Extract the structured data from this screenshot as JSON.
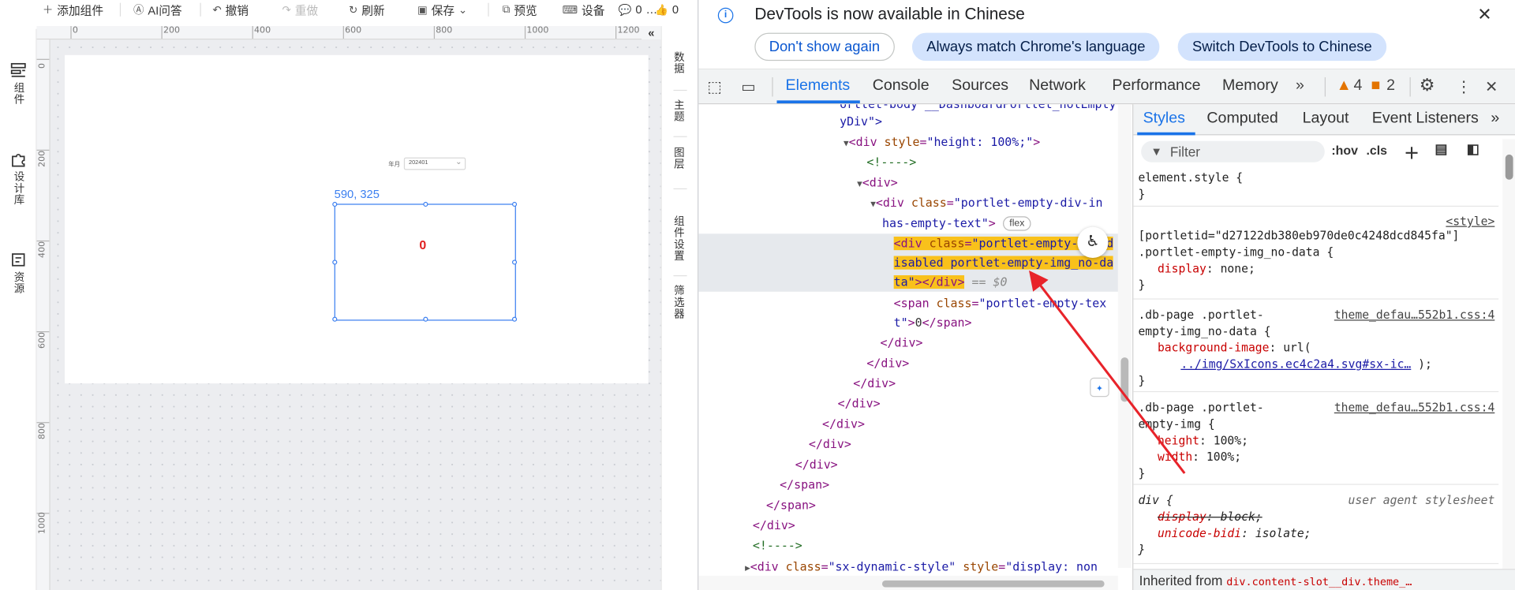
{
  "designer": {
    "toolbar": {
      "add_component": "添加组件",
      "ai_qa": "AI问答",
      "undo": "撤销",
      "redo": "重做",
      "refresh": "刷新",
      "save": "保存",
      "preview": "预览",
      "devices": "设备",
      "comments_count": "0",
      "likes_count": "0"
    },
    "left_sidebar": {
      "components": "组件",
      "design_library": "设计库",
      "resources": "资源"
    },
    "right_sidebar": {
      "data": "数据",
      "theme": "主题",
      "layers": "图层",
      "component_settings": "组件设置",
      "filters": "筛选器"
    },
    "ruler": {
      "h_labels": [
        "0",
        "200",
        "400",
        "600",
        "800",
        "1000",
        "1200"
      ],
      "v_labels": [
        "0",
        "200",
        "400",
        "600",
        "800",
        "1000"
      ]
    },
    "canvas": {
      "filter_label": "年月",
      "filter_value": "202401",
      "widget_coord": "590, 325",
      "widget_value": "0"
    }
  },
  "devtools": {
    "infobar": {
      "message": "DevTools is now available in Chinese",
      "btn_dont_show": "Don't show again",
      "btn_match_lang": "Always match Chrome's language",
      "btn_switch": "Switch DevTools to Chinese"
    },
    "tabs": [
      "Elements",
      "Console",
      "Sources",
      "Network",
      "Performance",
      "Memory"
    ],
    "warnings": "4",
    "errors": "2",
    "elements": {
      "line0": "ortlet-body __DashboardPortlet_notEmpty",
      "line1": "yDiv\">",
      "badge": "flex",
      "dollar0": "== $0",
      "text_content": "0"
    },
    "styles_tabs": [
      "Styles",
      "Computed",
      "Layout",
      "Event Listeners"
    ],
    "filter_placeholder": "Filter",
    "hov": ":hov",
    "cls": ".cls",
    "rules": {
      "element_style": "element.style {",
      "style_link": "<style>",
      "portlet_selector": "[portletid=\"d27122db380eb970de0c4248dcd845fa\"]",
      "portlet_class": ".portlet-empty-img_no-data {",
      "display_prop": "display",
      "display_none": "none;",
      "db_page_1a": ".db-page .portlet-",
      "db_page_1b": "empty-img_no-data {",
      "src": "theme_defau…552b1.css:4",
      "bg_prop": "background-image",
      "bg_url": "url(",
      "bg_link": "../img/SxIcons.ec4c2a4.svg#sx-ic…",
      "bg_end": ");",
      "db_page_2a": ".db-page .portlet-",
      "db_page_2b": "empty-img {",
      "height_prop": "height",
      "height_val": "100%;",
      "width_prop": "width",
      "width_val": "100%;",
      "div_sel": "div {",
      "ua": "user agent stylesheet",
      "display_block": "block;",
      "unicode_bidi": "unicode-bidi",
      "isolate": "isolate;",
      "close": "}"
    },
    "inherited_from": "Inherited from",
    "inherited_sel": "div.content-slot__div.theme_…"
  }
}
